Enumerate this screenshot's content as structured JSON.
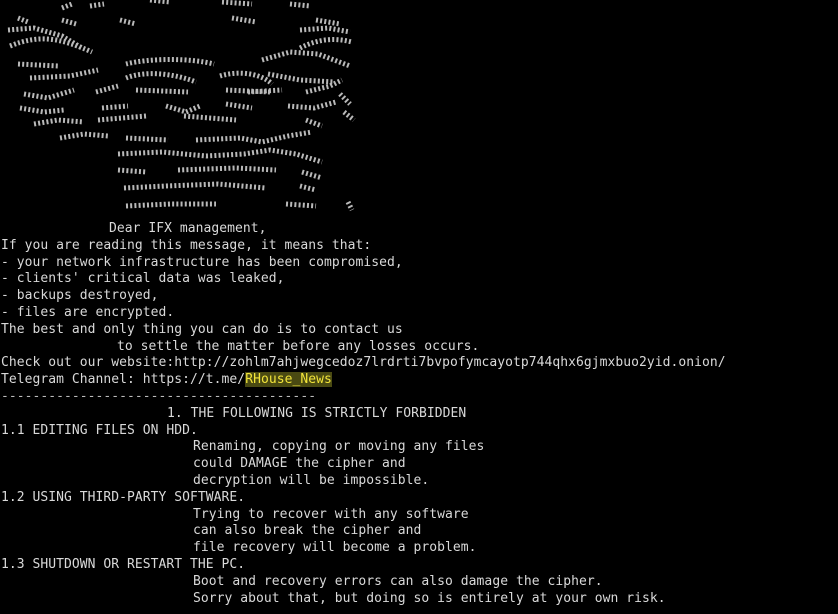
{
  "colors": {
    "background": "#000000",
    "text": "#d9d9d9",
    "highlight_text": "#f2e43a",
    "highlight_bg": "#4a4a12"
  },
  "ascii_art": {
    "icon": "skull-ascii-art-icon"
  },
  "note": {
    "greeting": "Dear IFX management,",
    "intro": "If you are reading this message, it means that:",
    "points": [
      "- your network infrastructure has been compromised,",
      "- clients' critical data was leaked,",
      "- backups destroyed,",
      "- files are encrypted."
    ],
    "contact_line_1": "The best and only thing you can do is to contact us",
    "contact_line_2": "to settle the matter before any losses occurs.",
    "website_line": "Check out our website:http://zohlm7ahjwegcedoz7lrdrti7bvpofymcayotp744qhx6gjmxbuo2yid.onion/",
    "telegram_prefix": "Telegram Channel: https://t.me/",
    "telegram_handle": "RHouse_News",
    "divider": "----------------------------------------",
    "section_heading": "1. THE FOLLOWING IS STRICTLY FORBIDDEN",
    "rules": [
      {
        "title": "1.1 EDITING FILES ON HDD.",
        "lines": [
          "Renaming, copying or moving any files",
          "could DAMAGE the cipher and",
          "decryption will be impossible."
        ]
      },
      {
        "title": "1.2 USING THIRD-PARTY SOFTWARE.",
        "lines": [
          "Trying to recover with any software",
          "can also break the cipher and",
          "file recovery will become a problem."
        ]
      },
      {
        "title": "1.3 SHUTDOWN OR RESTART THE PC.",
        "lines": [
          "Boot and recovery errors can also damage the cipher.",
          "Sorry about that, but doing so is entirely at your own risk."
        ]
      }
    ]
  }
}
